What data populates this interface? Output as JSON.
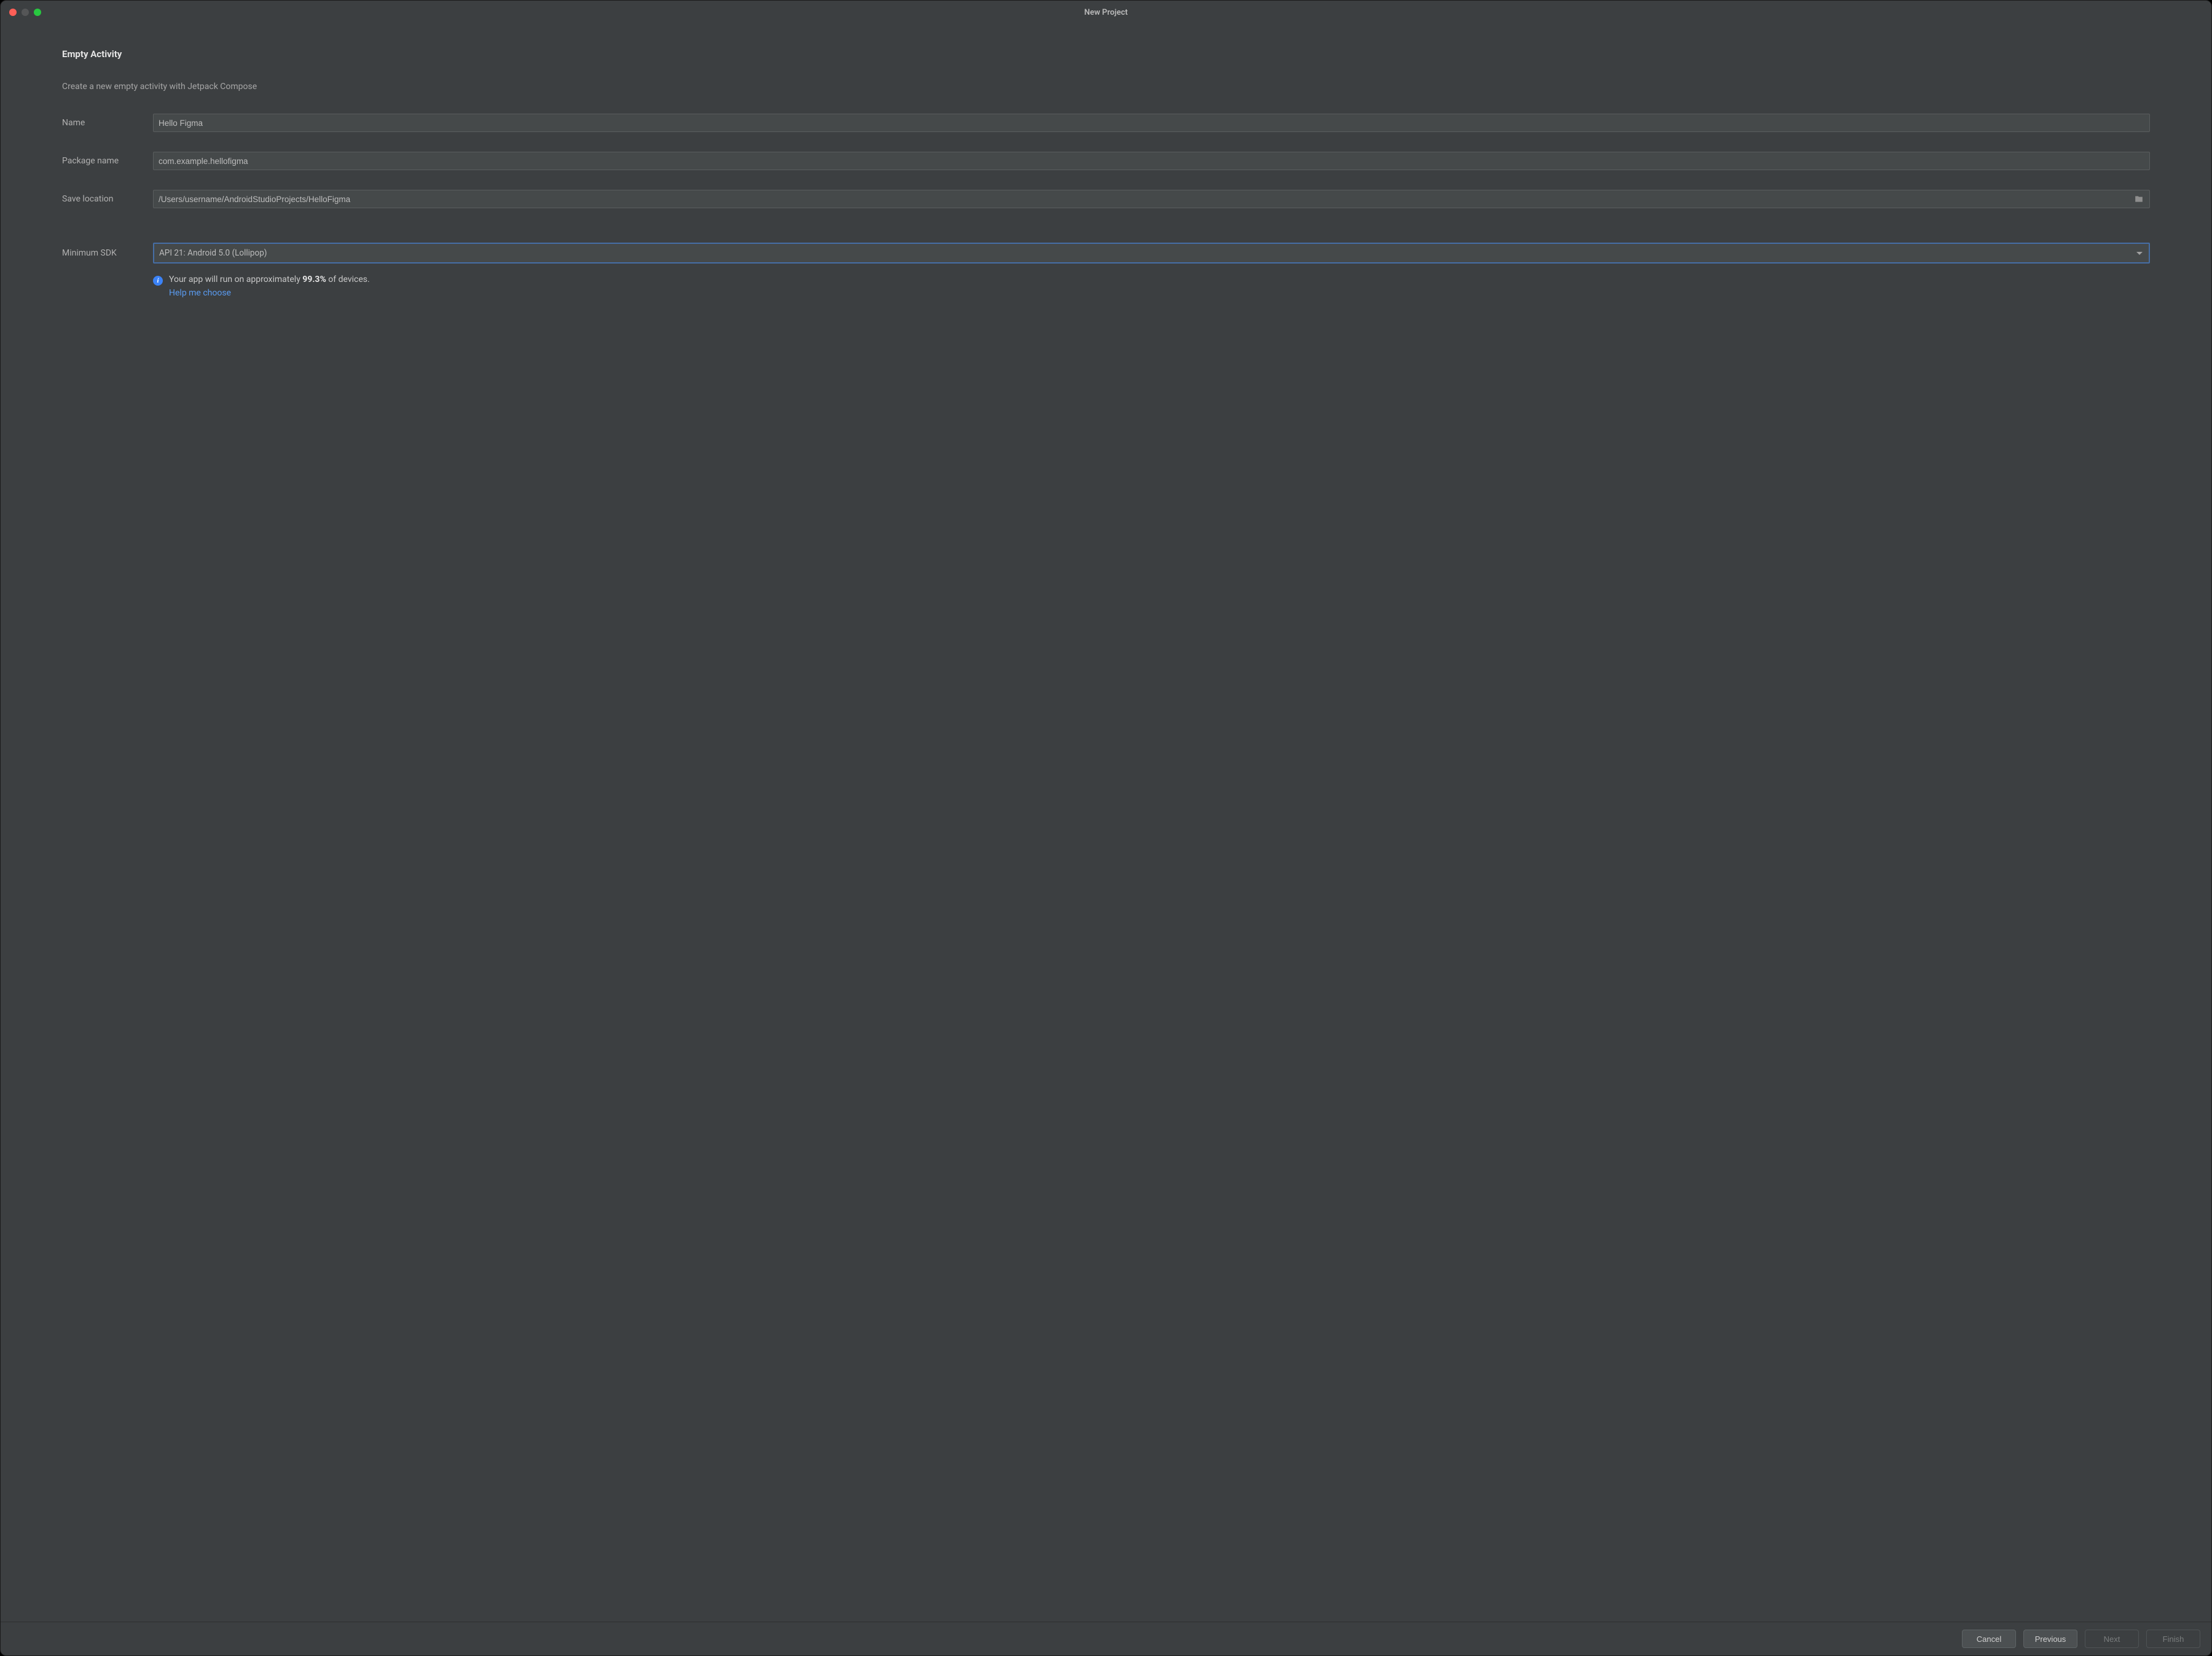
{
  "window": {
    "title": "New Project"
  },
  "heading": "Empty Activity",
  "description": "Create a new empty activity with Jetpack Compose",
  "labels": {
    "name": "Name",
    "package_name": "Package name",
    "save_location": "Save location",
    "minimum_sdk": "Minimum SDK"
  },
  "fields": {
    "name": "Hello Figma",
    "package_name": "com.example.hellofigma",
    "save_location": "/Users/username/AndroidStudioProjects/HelloFigma",
    "minimum_sdk": "API 21: Android 5.0 (Lollipop)"
  },
  "info": {
    "text_pre": "Your app will run on approximately ",
    "percent": "99.3%",
    "text_post": " of devices.",
    "help_link": "Help me choose"
  },
  "buttons": {
    "cancel": "Cancel",
    "previous": "Previous",
    "next": "Next",
    "finish": "Finish"
  }
}
